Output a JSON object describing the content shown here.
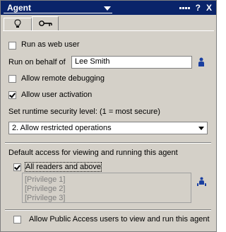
{
  "titlebar": {
    "title": "Agent",
    "help_label": "?",
    "close_label": "X",
    "bg_color": "#0a246a"
  },
  "tabs": [
    {
      "icon": "lightbulb-icon"
    },
    {
      "icon": "key-icon"
    }
  ],
  "options": {
    "run_as_web_user": {
      "label": "Run as web user",
      "checked": false
    },
    "run_on_behalf": {
      "label": "Run on behalf of",
      "value": "Lee Smith"
    },
    "remote_debugging": {
      "label": "Allow remote debugging",
      "checked": false
    },
    "user_activation": {
      "label": "Allow user activation",
      "checked": true
    }
  },
  "security": {
    "label": "Set runtime security level: (1 = most secure)",
    "selected": "2. Allow restricted operations"
  },
  "access": {
    "heading": "Default access for viewing and running this agent",
    "all_readers_label": "All readers and above",
    "all_readers_checked": true,
    "privileges": [
      "[Privilege 1]",
      "[Privilege 2]",
      "[Privilege 3]"
    ]
  },
  "public_access": {
    "label": "Allow Public Access users to view and run this agent",
    "checked": false
  }
}
